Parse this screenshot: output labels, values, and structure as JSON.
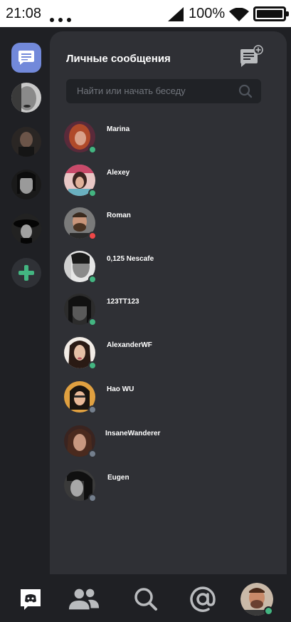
{
  "status_bar": {
    "time": "21:08",
    "battery_pct": "100%"
  },
  "guilds": [
    {
      "name": "dm-home",
      "icon": "chat-bubble-icon",
      "active": true
    },
    {
      "name": "server-1",
      "icon": "avatar"
    },
    {
      "name": "server-2",
      "icon": "avatar"
    },
    {
      "name": "server-3",
      "icon": "avatar"
    },
    {
      "name": "server-4",
      "icon": "avatar"
    },
    {
      "name": "add-server",
      "icon": "plus-icon"
    }
  ],
  "panel": {
    "title": "Личные сообщения",
    "search_placeholder": "Найти или начать беседу"
  },
  "dms": [
    {
      "name": "Marina",
      "status": "online"
    },
    {
      "name": "Alexey",
      "status": "online"
    },
    {
      "name": "Roman",
      "status": "dnd"
    },
    {
      "name": "0,125 Nescafe",
      "status": "online"
    },
    {
      "name": "123TT123",
      "status": "online"
    },
    {
      "name": "AlexanderWF",
      "status": "online"
    },
    {
      "name": "Hao WU",
      "status": "offline"
    },
    {
      "name": "InsaneWanderer",
      "status": "offline"
    },
    {
      "name": "Eugen",
      "status": "offline"
    }
  ],
  "colors": {
    "accent": "#7289da",
    "online": "#43b581",
    "dnd": "#f04747",
    "offline": "#747f8d",
    "add": "#43b581"
  },
  "nav": [
    "discord-home-icon",
    "friends-icon",
    "search-icon",
    "mentions-icon",
    "profile-avatar"
  ]
}
